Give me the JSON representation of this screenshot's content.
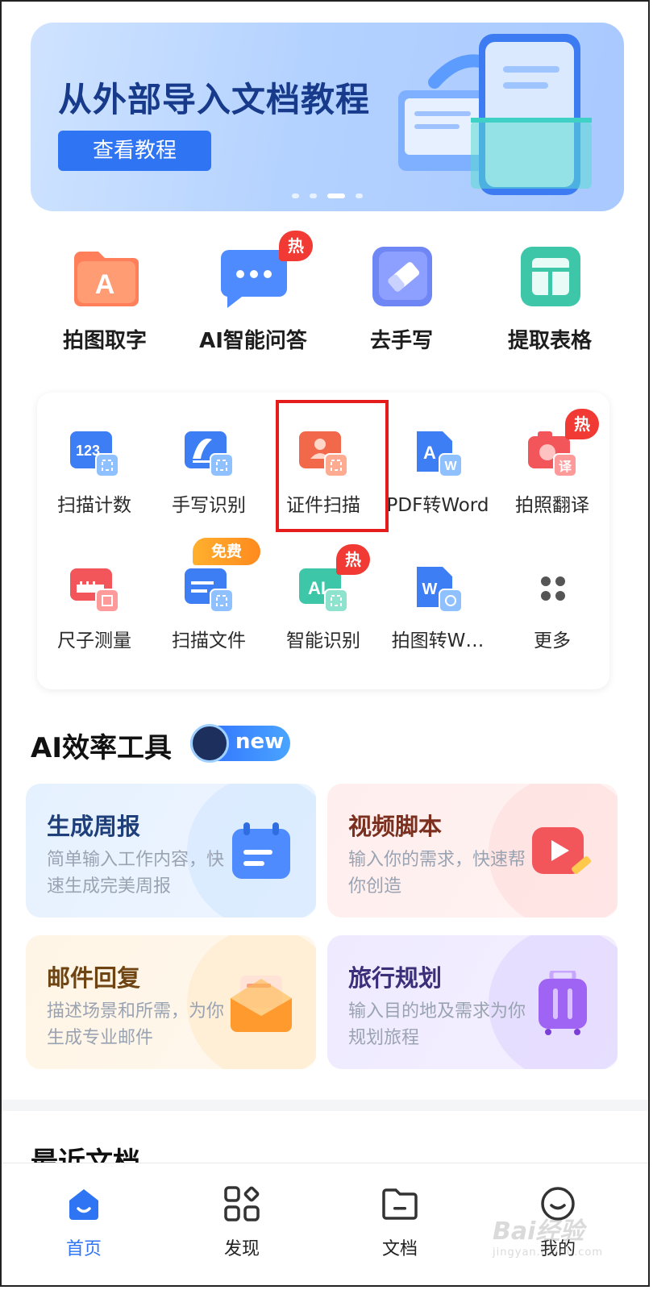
{
  "banner": {
    "title": "从外部导入文档教程",
    "button": "查看教程",
    "page_indicator": {
      "count": 4,
      "active_index": 2
    }
  },
  "quick_tools": [
    {
      "label": "拍图取字",
      "icon": "text-a-icon"
    },
    {
      "label": "AI智能问答",
      "icon": "chat-bubble-icon",
      "badge": "热"
    },
    {
      "label": "去手写",
      "icon": "eraser-icon"
    },
    {
      "label": "提取表格",
      "icon": "table-icon"
    }
  ],
  "grid_tools": [
    {
      "label": "扫描计数",
      "icon": "scan-count-icon"
    },
    {
      "label": "手写识别",
      "icon": "handwriting-icon"
    },
    {
      "label": "证件扫描",
      "icon": "id-card-scan-icon"
    },
    {
      "label": "PDF转Word",
      "icon": "pdf-to-word-icon"
    },
    {
      "label": "拍照翻译",
      "icon": "photo-translate-icon",
      "badge": "热",
      "icon_text": "译"
    },
    {
      "label": "尺子测量",
      "icon": "ruler-icon"
    },
    {
      "label": "扫描文件",
      "icon": "scan-file-icon",
      "badge": "免费"
    },
    {
      "label": "智能识别",
      "icon": "ai-recognize-icon",
      "badge": "热",
      "icon_text": "AI"
    },
    {
      "label": "拍图转W…",
      "icon": "photo-to-word-icon"
    },
    {
      "label": "更多",
      "icon": "more-dots-icon"
    }
  ],
  "ai_section": {
    "title": "AI效率工具",
    "new_badge": "new",
    "cards": [
      {
        "title": "生成周报",
        "desc": "简单输入工作内容，快速生成完美周报",
        "icon": "calendar-report-icon"
      },
      {
        "title": "视频脚本",
        "desc": "输入你的需求，快速帮你创造",
        "icon": "video-script-icon"
      },
      {
        "title": "邮件回复",
        "desc": "描述场景和所需，为你生成专业邮件",
        "icon": "mail-envelope-icon"
      },
      {
        "title": "旅行规划",
        "desc": "输入目的地及需求为你规划旅程",
        "icon": "suitcase-icon"
      }
    ]
  },
  "recent_docs": {
    "title": "最近文档"
  },
  "tabbar": [
    {
      "label": "首页",
      "icon": "home-icon",
      "active": true
    },
    {
      "label": "发现",
      "icon": "discover-grid-icon"
    },
    {
      "label": "文档",
      "icon": "folder-icon"
    },
    {
      "label": "我的",
      "icon": "profile-smile-icon"
    }
  ],
  "watermark": {
    "brand": "Bai经验",
    "url": "jingyan.baidu.com"
  },
  "colors": {
    "accent": "#2f74f2",
    "hot_badge": "#f03a33",
    "highlight": "#e51c1c"
  }
}
